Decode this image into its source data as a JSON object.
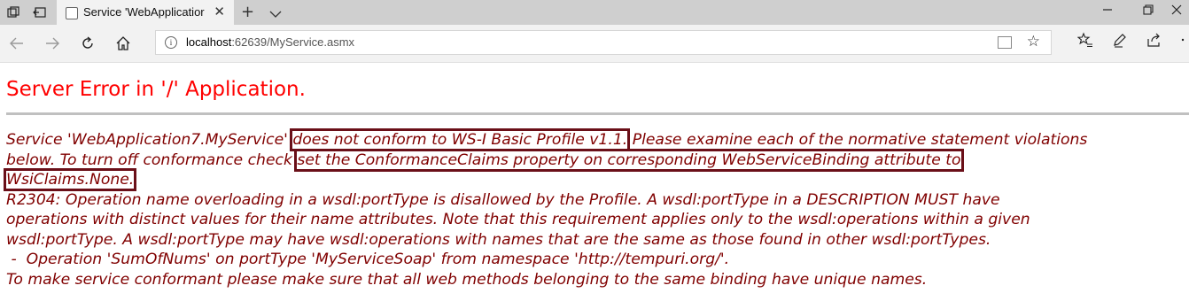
{
  "browser": {
    "tab_title": "Service 'WebApplicatior",
    "new_tab_symbol": "+",
    "tab_close_symbol": "✕",
    "url_host": "localhost",
    "url_rest": ":62639/MyService.asmx"
  },
  "page": {
    "title": "Server Error in '/' Application.",
    "line1_a": "Service 'WebApplication7.MyService'",
    "line1_hl": "does not conform to WS-I Basic Profile v1.1.",
    "line1_b": "Please examine each of the normative statement violations",
    "line2_a": "below. To turn off conformance check",
    "line2_hl": "set the ConformanceClaims property on corresponding WebServiceBinding attribute to",
    "line3_hl": "WsiClaims.None.",
    "line4": "R2304: Operation name overloading in a wsdl:portType is disallowed by the Profile. A wsdl:portType in a DESCRIPTION MUST have",
    "line5": "operations with distinct values for their name attributes. Note that this requirement applies only to the wsdl:operations within a given",
    "line6": "wsdl:portType. A wsdl:portType may have wsdl:operations with names that are the same as those found in other wsdl:portTypes.",
    "line7": " -  Operation 'SumOfNums' on portType 'MyServiceSoap' from namespace 'http://tempuri.org/'.",
    "line8": "To make service conformant please make sure that all web methods belonging to the same binding have unique names."
  },
  "colors": {
    "title_red": "#ff0000",
    "error_text": "#800000",
    "highlight_box": "#6a0f18"
  }
}
